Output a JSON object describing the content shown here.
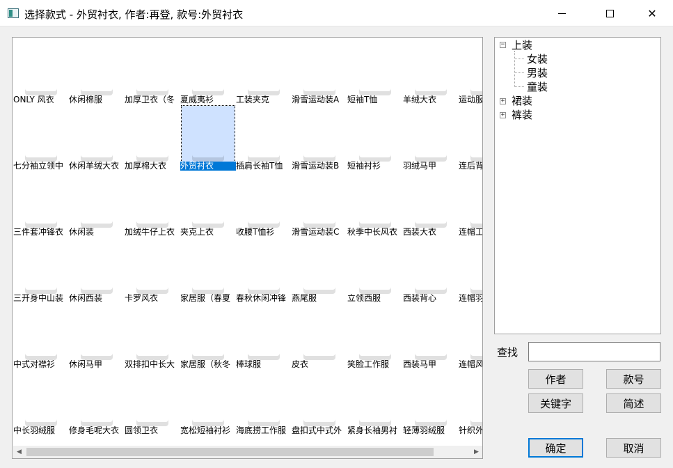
{
  "window": {
    "title": "选择款式 - 外贸衬衣, 作者:再登, 款号:外贸衬衣",
    "minimize_icon": "minimize-icon",
    "maximize_icon": "maximize-icon",
    "close_glyph": "✕"
  },
  "grid": {
    "rows": [
      [
        {
          "label": "ONLY 风衣",
          "color": "#c9b79a"
        },
        {
          "label": "休闲棉服",
          "color": "#b98a4e"
        },
        {
          "label": "加厚卫衣（冬",
          "color": "#2b2b2b"
        },
        {
          "label": "夏威夷衫",
          "color": "#3fb0c9"
        },
        {
          "label": "工装夹克",
          "color": "#9c7a4a"
        },
        {
          "label": "滑雪运动装A",
          "color": "#2f4f7a"
        },
        {
          "label": "短袖T恤",
          "color": "#f4f4f4"
        },
        {
          "label": "羊绒大衣",
          "color": "#8c8c8c"
        },
        {
          "label": "运动服",
          "color": "#2c8fd6"
        }
      ],
      [
        {
          "label": "七分袖立领中",
          "color": "#ececec"
        },
        {
          "label": "休闲羊绒大衣",
          "color": "#4a4a4a"
        },
        {
          "label": "加厚棉大衣",
          "color": "#1e1e1e"
        },
        {
          "label": "外贸衬衣",
          "color": "#f2f2f2",
          "selected": true
        },
        {
          "label": "插肩长袖T恤",
          "color": "#2b2f4a"
        },
        {
          "label": "滑雪运动装B",
          "color": "#1ba0c4"
        },
        {
          "label": "短袖衬衫",
          "color": "#d6e4f5"
        },
        {
          "label": "羽绒马甲",
          "color": "#2e3142"
        },
        {
          "label": "连后背",
          "color": "#333333"
        }
      ],
      [
        {
          "label": "三件套冲锋衣",
          "color": "#1f2a33"
        },
        {
          "label": "休闲装",
          "color": "#bcd3e8"
        },
        {
          "label": "加绒牛仔上衣",
          "color": "#2a2a2a"
        },
        {
          "label": "夹克上衣",
          "color": "#25324a"
        },
        {
          "label": "收腰T恤衫",
          "color": "#9fc1d9"
        },
        {
          "label": "滑雪运动装C",
          "color": "#c8a400"
        },
        {
          "label": "秋季中长风衣",
          "color": "#c7a77f"
        },
        {
          "label": "西装大衣",
          "color": "#1c1c1c"
        },
        {
          "label": "连帽工",
          "color": "#1e5fd1"
        }
      ],
      [
        {
          "label": "三开身中山装",
          "color": "#3a3a3a"
        },
        {
          "label": "休闲西装",
          "color": "#a8a8a8"
        },
        {
          "label": "卡罗风衣",
          "color": "#7d6a4c"
        },
        {
          "label": "家居服（春夏",
          "color": "#2e2a2a"
        },
        {
          "label": "春秋休闲冲锋",
          "color": "#4b5a3c"
        },
        {
          "label": "燕尾服",
          "color": "#1a1a1a"
        },
        {
          "label": "立领西服",
          "color": "#151515"
        },
        {
          "label": "西装背心",
          "color": "#1c1c1c"
        },
        {
          "label": "连帽羽",
          "color": "#e9e4dc"
        }
      ],
      [
        {
          "label": "中式对襟衫",
          "color": "#ece6d8"
        },
        {
          "label": "休闲马甲",
          "color": "#555555"
        },
        {
          "label": "双排扣中长大",
          "color": "#8ea4c4"
        },
        {
          "label": "家居服（秋冬",
          "color": "#1f2c55"
        },
        {
          "label": "棒球服",
          "color": "#d8d4cc"
        },
        {
          "label": "皮衣",
          "color": "#2a1d17"
        },
        {
          "label": "笑脸工作服",
          "color": "#eeeeee"
        },
        {
          "label": "西装马甲",
          "color": "#888888"
        },
        {
          "label": "连帽风",
          "color": "#5d6848"
        }
      ],
      [
        {
          "label": "中长羽绒服",
          "color": "#1c1c1c"
        },
        {
          "label": "修身毛呢大衣",
          "color": "#2a2a2a"
        },
        {
          "label": "圆领卫衣",
          "color": "#3e5c96"
        },
        {
          "label": "宽松短袖衬衫",
          "color": "#efefef"
        },
        {
          "label": "海底捞工作服",
          "color": "#c7d8c0"
        },
        {
          "label": "盘扣式中式外",
          "color": "#e6dac4"
        },
        {
          "label": "紧身长袖男衬",
          "color": "#3e6fb3"
        },
        {
          "label": "轻薄羽绒服",
          "color": "#1f4fb0"
        },
        {
          "label": "针织外",
          "color": "#a4886a"
        }
      ]
    ],
    "scroll_left_glyph": "◀",
    "scroll_right_glyph": "▶"
  },
  "tree": {
    "root": {
      "label": "上装",
      "toggle": "−",
      "children": [
        "女装",
        "男装",
        "童装"
      ]
    },
    "others": [
      {
        "label": "裙装",
        "toggle": "+"
      },
      {
        "label": "裤装",
        "toggle": "+"
      }
    ]
  },
  "search": {
    "label": "查找",
    "value": ""
  },
  "buttons": {
    "author": "作者",
    "style_no": "款号",
    "keyword": "关键字",
    "brief": "简述",
    "ok": "确定",
    "cancel": "取消"
  }
}
